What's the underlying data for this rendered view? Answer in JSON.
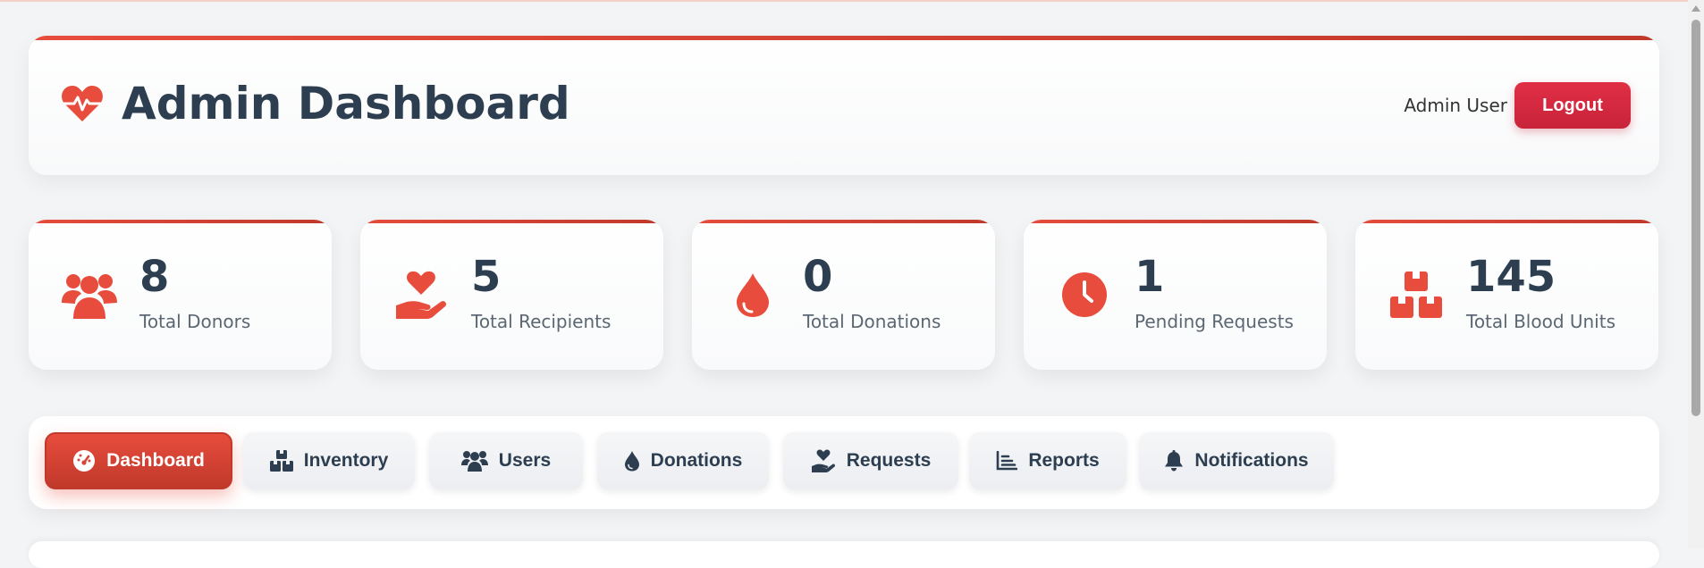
{
  "header": {
    "title": "Admin Dashboard",
    "logo_icon": "heart-pulse-icon",
    "user_name": "Admin User",
    "logout_label": "Logout"
  },
  "stats": [
    {
      "icon": "users-icon",
      "value": "8",
      "label": "Total Donors"
    },
    {
      "icon": "hand-holding-heart-icon",
      "value": "5",
      "label": "Total Recipients"
    },
    {
      "icon": "blood-drop-icon",
      "value": "0",
      "label": "Total Donations"
    },
    {
      "icon": "clock-icon",
      "value": "1",
      "label": "Pending Requests"
    },
    {
      "icon": "boxes-icon",
      "value": "145",
      "label": "Total Blood Units"
    }
  ],
  "nav": {
    "active_tab": "Dashboard",
    "tabs": [
      {
        "icon": "gauge-icon",
        "label": "Dashboard"
      },
      {
        "icon": "boxes-icon",
        "label": "Inventory"
      },
      {
        "icon": "users-icon",
        "label": "Users"
      },
      {
        "icon": "blood-drop-icon",
        "label": "Donations"
      },
      {
        "icon": "hand-holding-heart-icon",
        "label": "Requests"
      },
      {
        "icon": "chart-icon",
        "label": "Reports"
      },
      {
        "icon": "bell-icon",
        "label": "Notifications"
      }
    ]
  },
  "colors": {
    "accent": "#e74c3c",
    "accent_dark": "#c0392b",
    "logout": "#d42a40",
    "text_dark": "#2c3e50",
    "text_muted": "#5b6773",
    "background": "#f3f4f6"
  }
}
